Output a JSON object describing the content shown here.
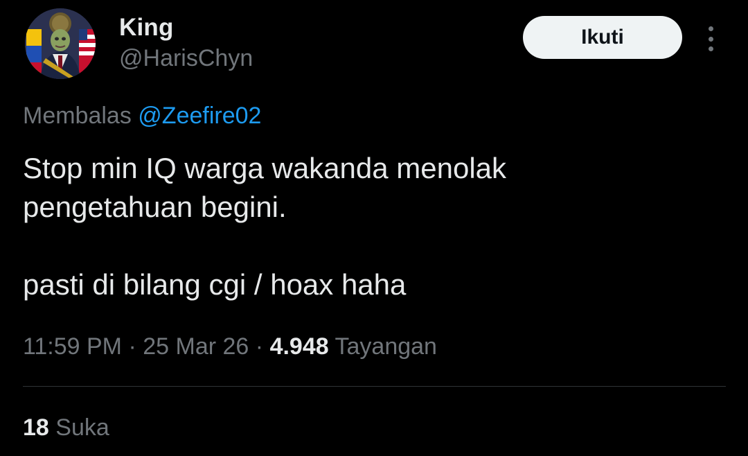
{
  "author": {
    "display_name": "King",
    "handle": "@HarisChyn",
    "avatar_icon": "avatar-image"
  },
  "follow_button_label": "Ikuti",
  "more_icon": "more-options-icon",
  "reply": {
    "prefix": "Membalas",
    "mention": "@Zeefire02"
  },
  "tweet": {
    "line1": "Stop min IQ warga wakanda menolak",
    "line2": "pengetahuan begini.",
    "line3": "pasti di bilang cgi / hoax haha"
  },
  "meta": {
    "time": "11:59 PM",
    "separator": "·",
    "date": "25 Mar 26",
    "views_count": "4.948",
    "views_label": "Tayangan"
  },
  "stats": {
    "likes_count": "18",
    "likes_label": "Suka"
  },
  "colors": {
    "background": "#000000",
    "text_primary": "#e7e9ea",
    "text_secondary": "#71767b",
    "link": "#1d9bf0",
    "button_bg": "#eff3f4",
    "divider": "#2f3336"
  }
}
